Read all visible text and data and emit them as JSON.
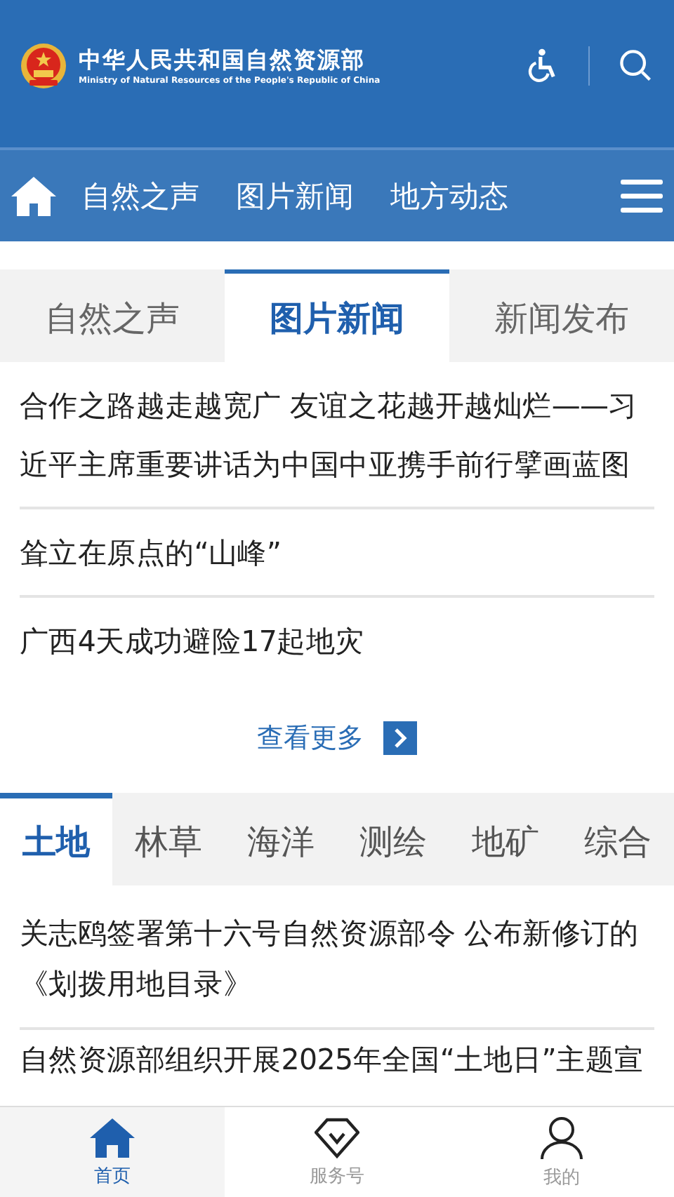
{
  "header": {
    "title": "中华人民共和国自然资源部",
    "subtitle": "Ministry of Natural Resources of the People's Republic of China"
  },
  "nav": {
    "items": [
      "自然之声",
      "图片新闻",
      "地方动态"
    ]
  },
  "tabs": [
    {
      "label": "自然之声",
      "selected": false
    },
    {
      "label": "图片新闻",
      "selected": true
    },
    {
      "label": "新闻发布",
      "selected": false
    }
  ],
  "news": [
    "合作之路越走越宽广 友谊之花越开越灿烂——习近平主席重要讲话为中国中亚携手前行擘画蓝图",
    "耸立在原点的“山峰”",
    "广西4天成功避险17起地灾"
  ],
  "more": "查看更多",
  "categories": [
    {
      "label": "土地",
      "selected": true
    },
    {
      "label": "林草",
      "selected": false
    },
    {
      "label": "海洋",
      "selected": false
    },
    {
      "label": "测绘",
      "selected": false
    },
    {
      "label": "地矿",
      "selected": false
    },
    {
      "label": "综合",
      "selected": false
    }
  ],
  "category_news": [
    "关志鸥签署第十六号自然资源部令 公布新修订的《划拨用地目录》",
    "自然资源部组织开展2025年全国“土地日”主题宣"
  ],
  "bottom_nav": [
    {
      "label": "首页",
      "selected": true
    },
    {
      "label": "服务号",
      "selected": false
    },
    {
      "label": "我的",
      "selected": false
    }
  ]
}
